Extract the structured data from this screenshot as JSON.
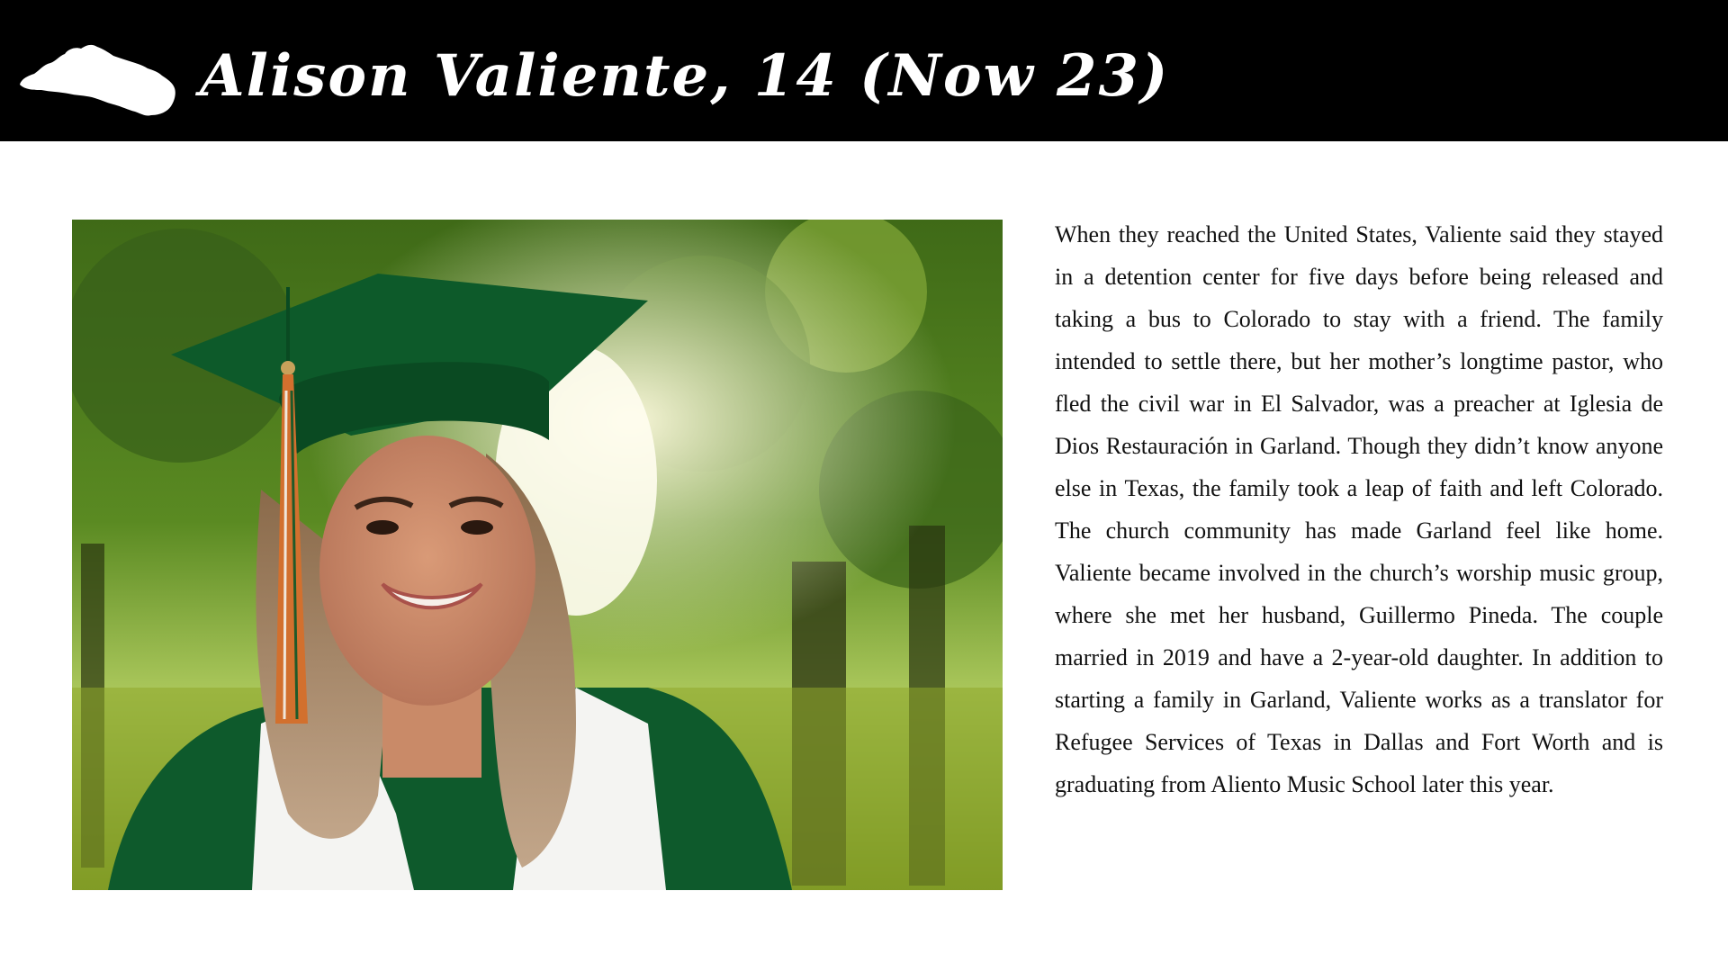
{
  "header": {
    "title": "Alison Valiente, 14 (Now 23)",
    "icon": "el-salvador-map-icon",
    "background_color": "#000000",
    "title_color": "#ffffff"
  },
  "photo": {
    "subject": "graduation-portrait",
    "gown_color": "#0e5a2c"
  },
  "article": {
    "paragraph": "When they reached the United States, Valiente said they stayed in a detention center for five days before being released and taking a bus to Colorado to stay with a friend. The family intended to settle there, but her mother’s longtime pastor, who fled the civil war in El Salvador, was a preacher at Iglesia de Dios Restauración in Garland. Though they didn’t know anyone else in Texas, the family took a leap of faith and left Colorado. The church community has made Garland feel like home. Valiente became involved in the church’s worship music group, where she met her husband, Guillermo Pineda. The couple married in 2019 and have a 2-year-old daughter. In addition to starting a family in Garland, Valiente works as a translator for Refugee Services of Texas in Dallas and Fort Worth and is graduating from Aliento Music School later this year."
  }
}
